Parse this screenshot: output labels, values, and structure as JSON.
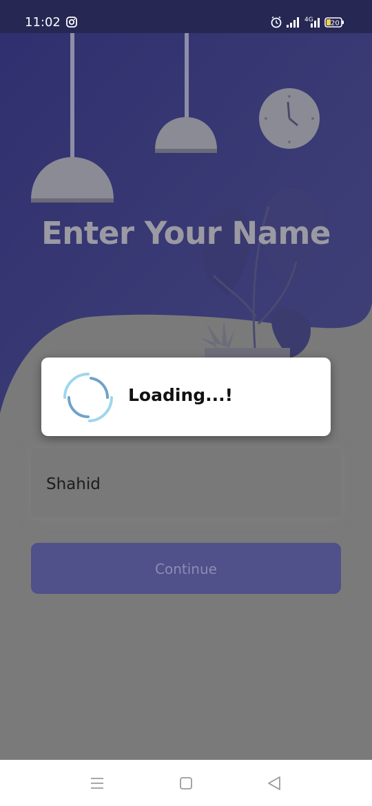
{
  "status_bar": {
    "time": "11:02",
    "network": "4G",
    "battery": "20",
    "icons": [
      "instagram-icon",
      "alarm-icon",
      "signal-icon",
      "signal-4g-icon",
      "battery-icon"
    ]
  },
  "screen": {
    "title": "Enter Your Name"
  },
  "name_input": {
    "value": "Shahid"
  },
  "continue_button": {
    "label": "Continue"
  },
  "loading_dialog": {
    "text": "Loading...!"
  },
  "nav_bar": {
    "icons": [
      "menu-icon",
      "home-icon",
      "back-icon"
    ]
  },
  "colors": {
    "background_top": "#383878",
    "background_bottom": "#7a7a7a",
    "accent": "#50508a",
    "status_bar": "#262753"
  }
}
